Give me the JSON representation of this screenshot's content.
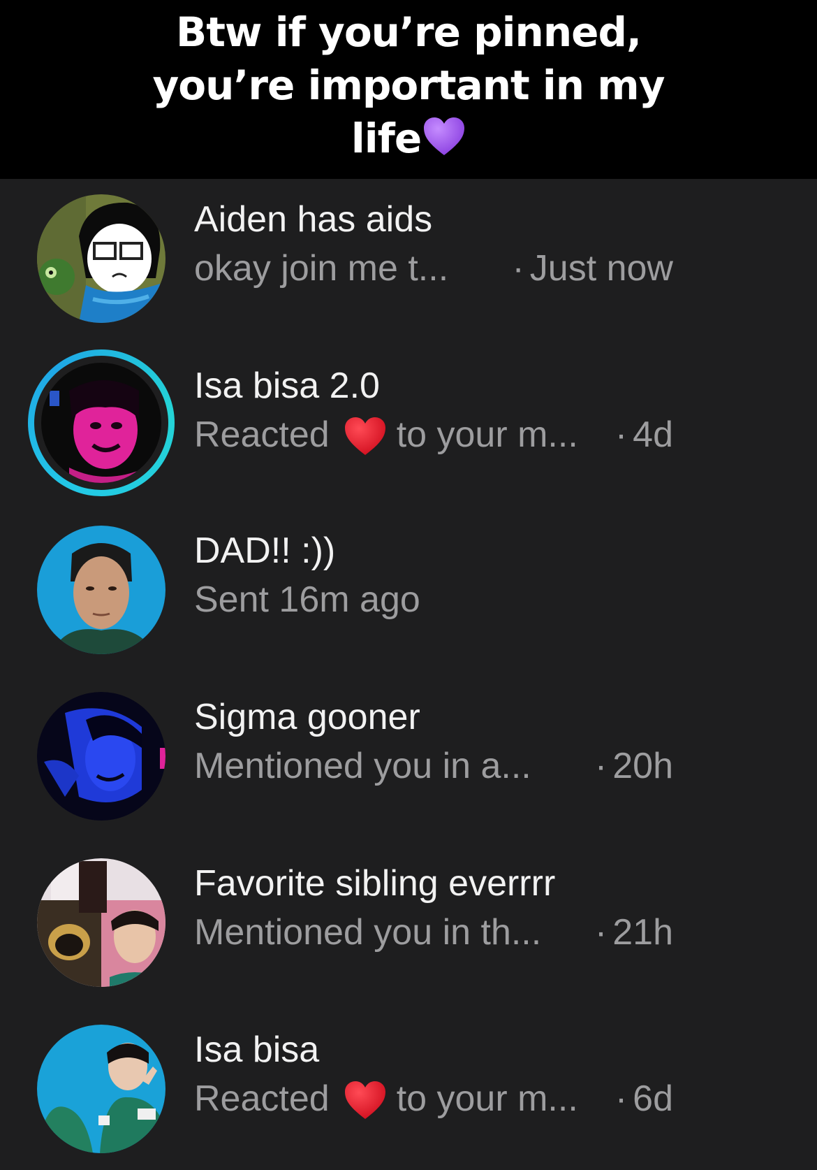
{
  "caption": {
    "line1": "Btw if you’re pinned,",
    "line2": "you’re important in my",
    "line3": "life",
    "emoji": "purple-heart"
  },
  "colors": {
    "background": "#1e1e1f",
    "caption_bg": "#000000",
    "name": "#f2f2f2",
    "secondary": "#9d9d9f",
    "story_ring": "#23c9e6",
    "heart_red": "#e8192c",
    "heart_purple": "#a45cf0"
  },
  "chats": [
    {
      "name": "Aiden has aids",
      "preview": "okay join me t...",
      "time": "Just now",
      "has_story_ring": false,
      "reaction": null
    },
    {
      "name": "Isa bisa 2.0",
      "preview_before": "Reacted",
      "preview_after": "to your m...",
      "time": "4d",
      "has_story_ring": true,
      "reaction": "red-heart"
    },
    {
      "name": "DAD!! :))",
      "preview": "Sent 16m ago",
      "time": "",
      "has_story_ring": false,
      "reaction": null
    },
    {
      "name": "Sigma gooner",
      "preview": "Mentioned you in a...",
      "time": "20h",
      "has_story_ring": false,
      "reaction": null
    },
    {
      "name": "Favorite sibling everrrr",
      "preview": "Mentioned you in th...",
      "time": "21h",
      "has_story_ring": false,
      "reaction": null
    },
    {
      "name": "Isa bisa",
      "preview_before": "Reacted",
      "preview_after": "to your m...",
      "time": "6d",
      "has_story_ring": false,
      "reaction": "red-heart"
    }
  ],
  "separator": "·"
}
